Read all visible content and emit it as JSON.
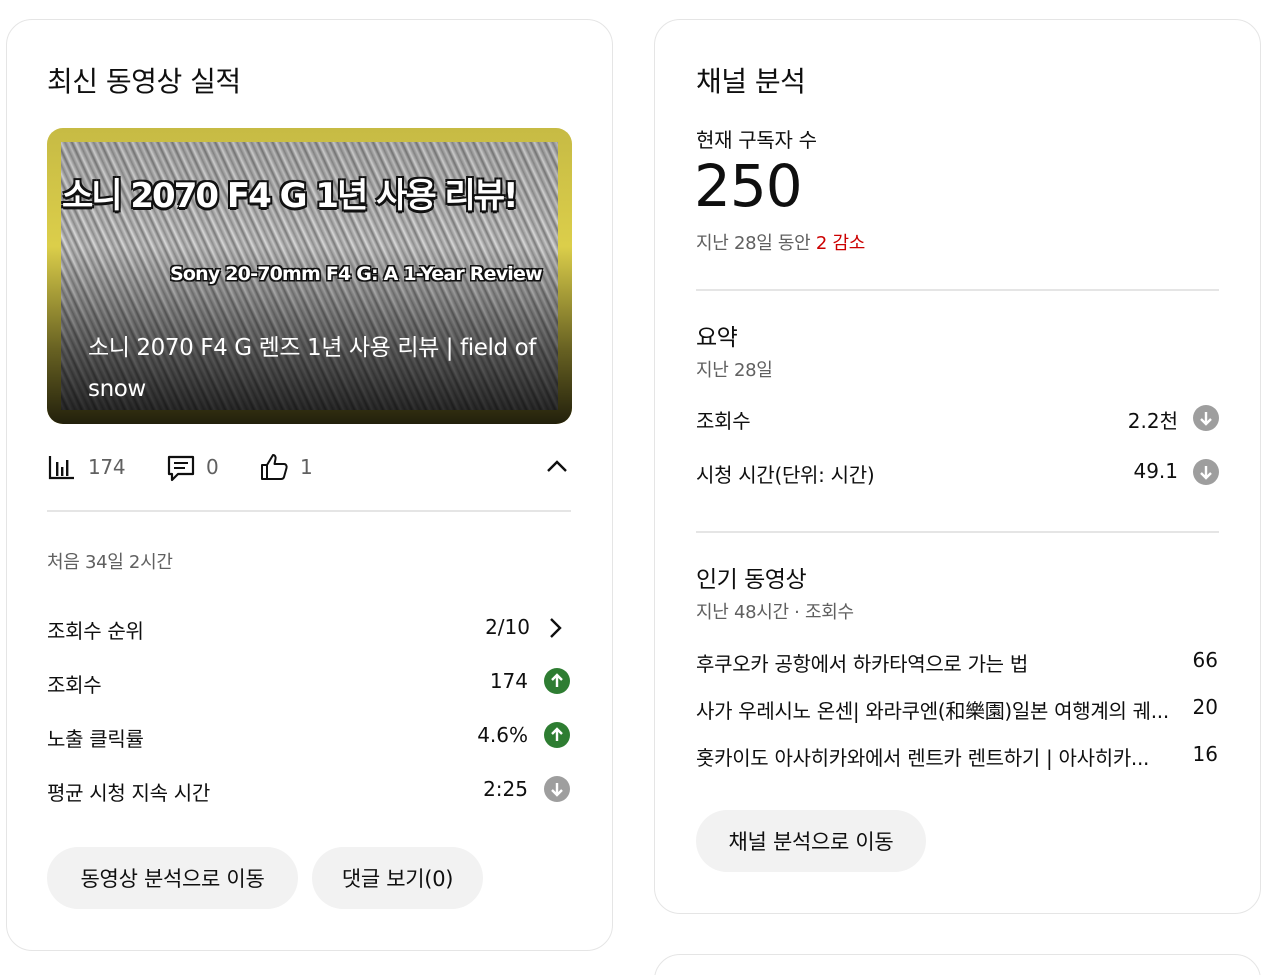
{
  "left": {
    "title": "최신 동영상 실적",
    "thumbnail": {
      "overlay_kr": "소니 2070 F4 G 1년 사용 리뷰!",
      "overlay_en": "Sony 20-70mm F4 G: A 1-Year Review",
      "video_title": "소니 2070 F4 G 렌즈 1년 사용 리뷰 | field of snow"
    },
    "stats": {
      "views": "174",
      "comments": "0",
      "likes": "1"
    },
    "period": "처음 34일 2시간",
    "rows": [
      {
        "label": "조회수 순위",
        "value": "2/10",
        "indicator": "chevron-right"
      },
      {
        "label": "조회수",
        "value": "174",
        "indicator": "up"
      },
      {
        "label": "노출 클릭률",
        "value": "4.6%",
        "indicator": "up"
      },
      {
        "label": "평균 시청 지속 시간",
        "value": "2:25",
        "indicator": "down"
      }
    ],
    "buttons": {
      "analytics": "동영상 분석으로 이동",
      "comments": "댓글 보기(0)"
    }
  },
  "right": {
    "title": "채널 분석",
    "subs_label": "현재 구독자 수",
    "subs_value": "250",
    "subs_change_prefix": "지난 28일 동안 ",
    "subs_change": "2 감소",
    "summary": {
      "title": "요약",
      "period": "지난 28일",
      "rows": [
        {
          "label": "조회수",
          "value": "2.2천",
          "indicator": "down"
        },
        {
          "label": "시청 시간(단위: 시간)",
          "value": "49.1",
          "indicator": "down"
        }
      ]
    },
    "popular": {
      "title": "인기 동영상",
      "period": "지난 48시간 · 조회수",
      "items": [
        {
          "title": "후쿠오카 공항에서 하카타역으로 가는 법",
          "views": "66"
        },
        {
          "title": "사가 우레시노 온센| 와라쿠엔(和樂園)일본 여행계의 궤...",
          "views": "20"
        },
        {
          "title": "홋카이도 아사히카와에서 렌트카 렌트하기 | 아사히카...",
          "views": "16"
        }
      ]
    },
    "button": "채널 분석으로 이동"
  },
  "colors": {
    "up": "#2e7d32",
    "down": "#9e9e9e",
    "decrease": "#cc0000",
    "thumb_border": "#e4d64b"
  }
}
